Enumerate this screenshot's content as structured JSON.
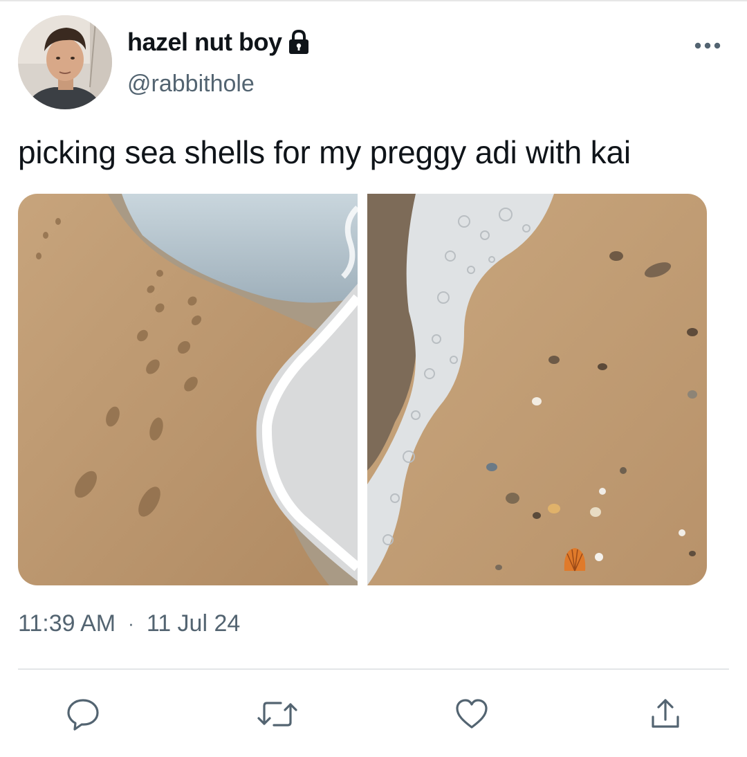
{
  "author": {
    "display_name": "hazel nut boy",
    "handle": "@rabbithole",
    "protected_icon": "lock-icon",
    "avatar_icon": "profile-photo"
  },
  "tweet": {
    "text": "picking sea shells for my preggy adi with kai",
    "media": [
      {
        "icon": "photo-footprints-beach"
      },
      {
        "icon": "photo-seashells-foam"
      }
    ],
    "time": "11:39 AM",
    "separator": "·",
    "date": "11 Jul 24"
  },
  "actions": [
    {
      "icon": "reply-icon"
    },
    {
      "icon": "retweet-icon"
    },
    {
      "icon": "like-icon"
    },
    {
      "icon": "share-icon"
    }
  ],
  "menu_icon": "more-options-icon",
  "colors": {
    "text_primary": "#0f1419",
    "text_secondary": "#536471",
    "divider": "#e3e6e8",
    "sand": "#c8a57c",
    "water": "#b9c6cf"
  }
}
